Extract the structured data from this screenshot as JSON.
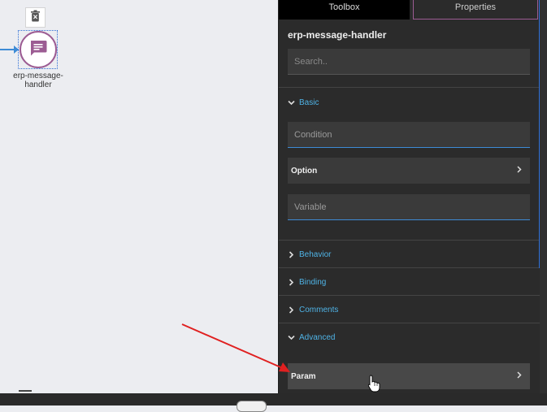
{
  "canvas": {
    "node": {
      "label": "erp-message-handler",
      "icon": "message-icon",
      "accent_color": "#9c5c93",
      "selection_color": "#2f6fd6",
      "connector_color": "#3d8bd6"
    },
    "delete_icon": "trash-icon"
  },
  "panel": {
    "tabs": [
      {
        "label": "Toolbox",
        "active": false
      },
      {
        "label": "Properties",
        "active": true
      }
    ],
    "title": "erp-message-handler",
    "search": {
      "placeholder": "Search..",
      "value": ""
    },
    "sections": {
      "basic": {
        "label": "Basic",
        "expanded": true,
        "fields": {
          "condition": {
            "placeholder": "Condition"
          },
          "option": {
            "label": "Option"
          },
          "variable": {
            "placeholder": "Variable"
          }
        }
      },
      "behavior": {
        "label": "Behavior",
        "expanded": false
      },
      "binding": {
        "label": "Binding",
        "expanded": false
      },
      "comments": {
        "label": "Comments",
        "expanded": false
      },
      "advanced": {
        "label": "Advanced",
        "expanded": true,
        "fields": {
          "param": {
            "label": "Param"
          }
        }
      }
    },
    "colors": {
      "section_text": "#4fb3e6",
      "panel_bg": "#2b2b2b",
      "field_bg": "#3a3a3a"
    }
  },
  "annotation": {
    "arrow_color": "#e02020"
  }
}
